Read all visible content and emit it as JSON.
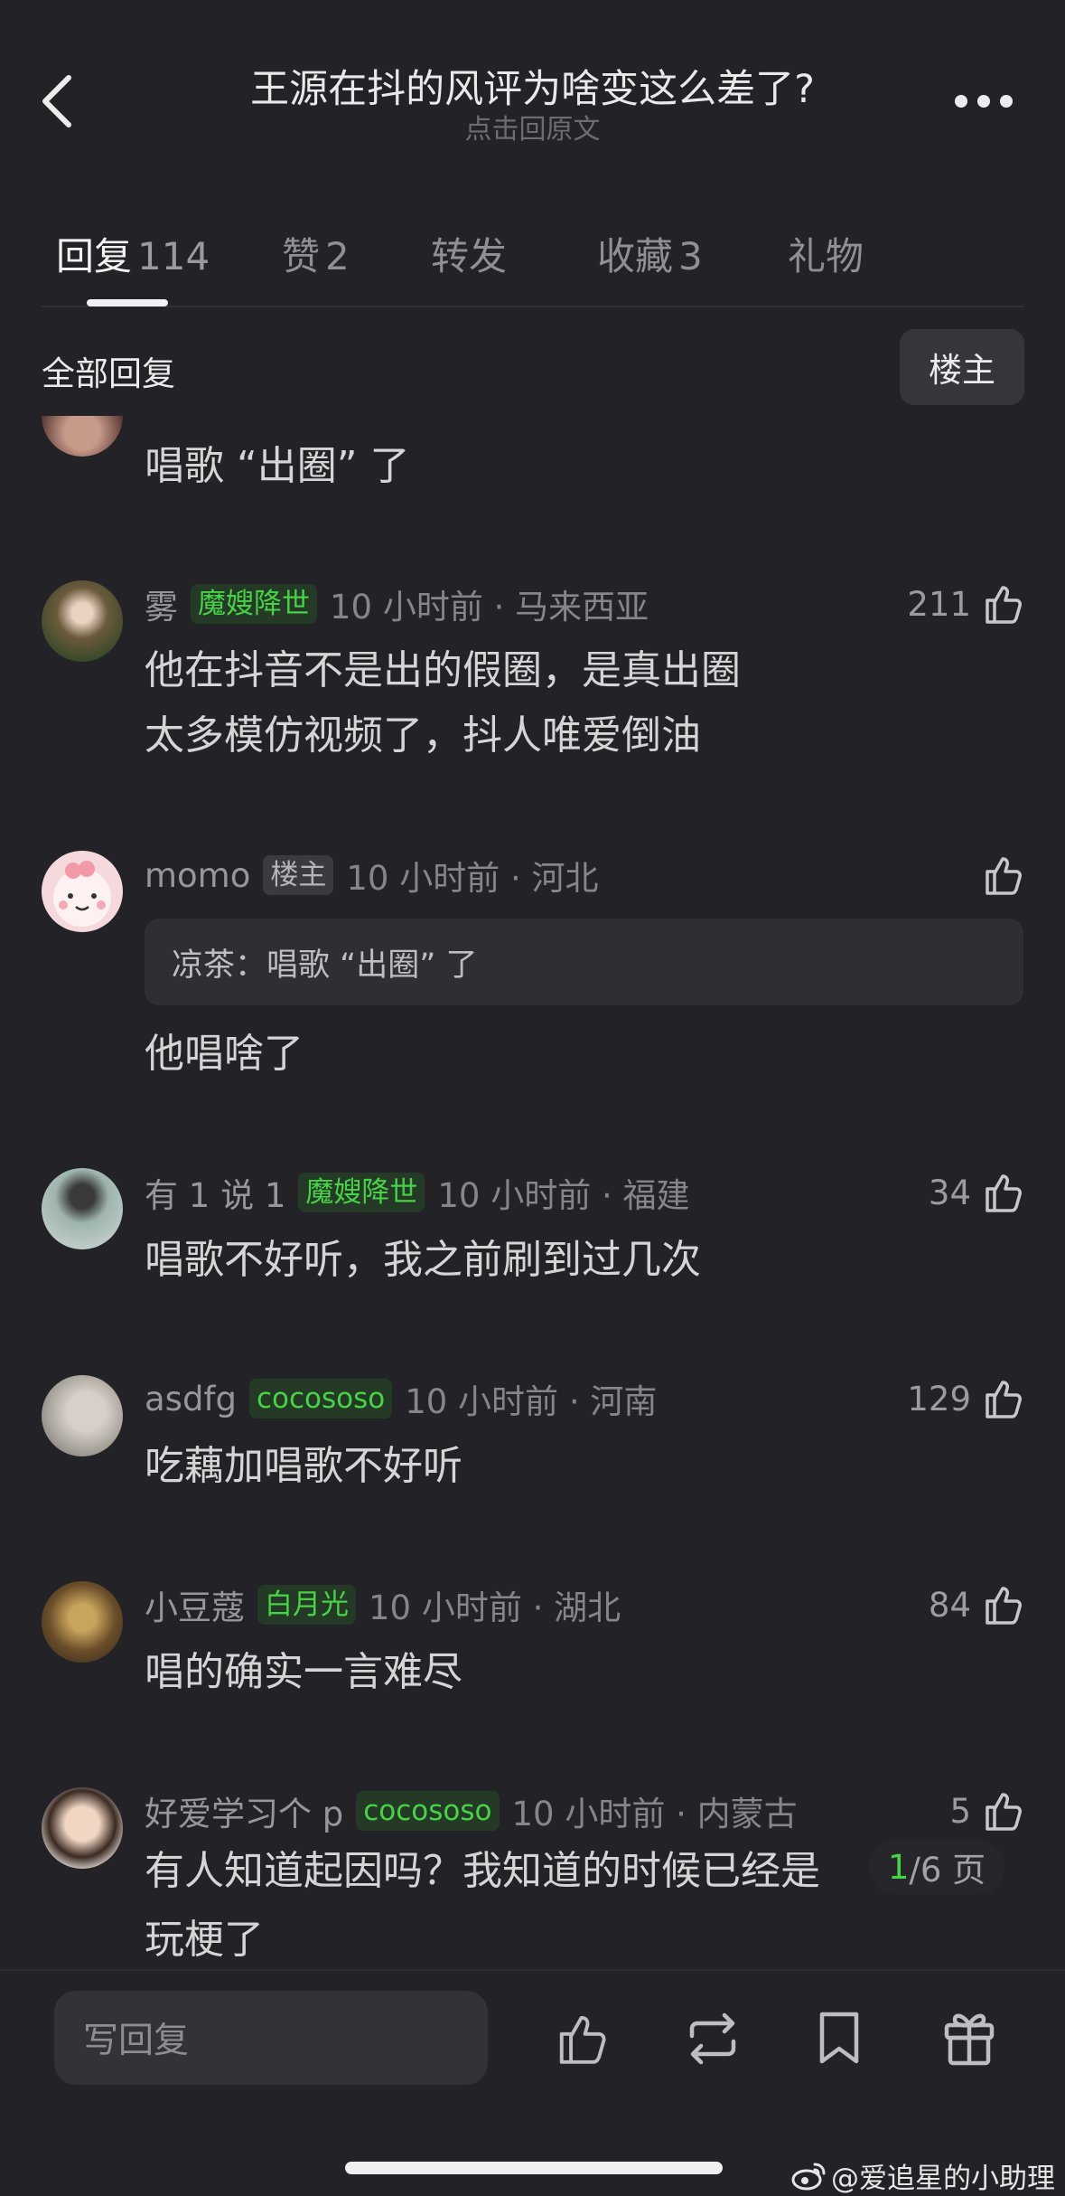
{
  "header": {
    "title": "王源在抖的风评为啥变这么差了?",
    "subtitle": "点击回原文"
  },
  "tabs": [
    {
      "label": "回复",
      "count": "114"
    },
    {
      "label": "赞",
      "count": "2"
    },
    {
      "label": "转发",
      "count": ""
    },
    {
      "label": "收藏",
      "count": "3"
    },
    {
      "label": "礼物",
      "count": ""
    }
  ],
  "filter": {
    "all_label": "全部回复",
    "owner_label": "楼主"
  },
  "comments": [
    {
      "text": "唱歌 “出圈” 了"
    },
    {
      "name": "雾",
      "badge": "魔嫂降世",
      "time": "10 小时前 · 马来西亚",
      "likes": "211",
      "text1": "他在抖音不是出的假圈，是真出圈",
      "text2": "太多模仿视频了，抖人唯爱倒油"
    },
    {
      "name": "momo",
      "badge": "楼主",
      "time": "10 小时前 · 河北",
      "likes": "",
      "quote": "凉茶：唱歌 “出圈” 了",
      "text1": "他唱啥了"
    },
    {
      "name": "有 1 说 1",
      "badge": "魔嫂降世",
      "time": "10 小时前 · 福建",
      "likes": "34",
      "text1": "唱歌不好听，我之前刷到过几次"
    },
    {
      "name": "asdfg",
      "badge": "cocososo",
      "time": "10 小时前 · 河南",
      "likes": "129",
      "text1": "吃藕加唱歌不好听"
    },
    {
      "name": "小豆蔻",
      "badge": "白月光",
      "time": "10 小时前 · 湖北",
      "likes": "84",
      "text1": "唱的确实一言难尽"
    },
    {
      "name": "好爱学习个 p",
      "badge": "cocososo",
      "time": "10 小时前 · 内蒙古",
      "likes": "5",
      "text1": "有人知道起因吗？我知道的时候已经是",
      "text2": "玩梗了"
    }
  ],
  "pager": {
    "current": "1",
    "rest": "/6 页"
  },
  "bottom": {
    "reply_placeholder": "写回复"
  },
  "watermark": "@爱追星的小助理",
  "colors": {
    "background": "#232327",
    "badge_green": "#47d247",
    "text": "#d5d5d8"
  }
}
